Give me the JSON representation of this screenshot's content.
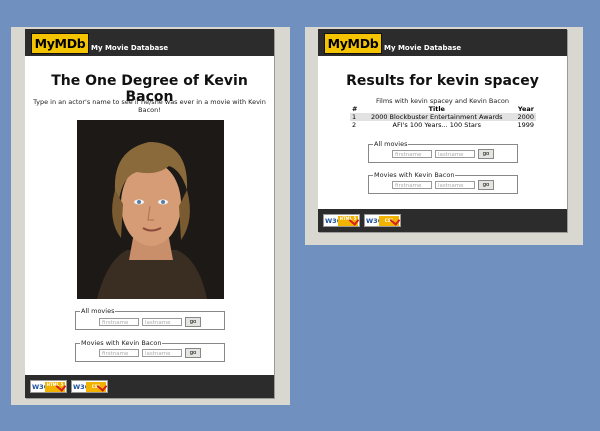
{
  "brand": {
    "logo": "MyMDb",
    "site_title": "My Movie Database"
  },
  "home": {
    "heading": "The One Degree of Kevin Bacon",
    "instructions": "Type in an actor's name to see if he/she was ever in a movie with Kevin Bacon!",
    "photo_alt": "Kevin Bacon",
    "all_movies": {
      "legend": "All movies",
      "first_placeholder": "firstname",
      "last_placeholder": "lastname",
      "go_label": "go"
    },
    "with_bacon": {
      "legend": "Movies with Kevin Bacon",
      "first_placeholder": "firstname",
      "last_placeholder": "lastname",
      "go_label": "go"
    }
  },
  "results": {
    "heading": "Results for kevin spacey",
    "caption": "Films with kevin spacey and Kevin Bacon",
    "columns": [
      "#",
      "Title",
      "Year"
    ],
    "rows": [
      {
        "num": "1",
        "title": "2000 Blockbuster Entertainment Awards",
        "year": "2000"
      },
      {
        "num": "2",
        "title": "AFI's 100 Years... 100 Stars",
        "year": "1999"
      }
    ],
    "all_movies": {
      "legend": "All movies",
      "first_placeholder": "firstname",
      "last_placeholder": "lastname",
      "go_label": "go"
    },
    "with_bacon": {
      "legend": "Movies with Kevin Bacon",
      "first_placeholder": "firstname",
      "last_placeholder": "lastname",
      "go_label": "go"
    }
  },
  "validators": {
    "html_label": "HTML 5",
    "css_label": "CSS",
    "w3c": "W3C"
  },
  "colors": {
    "background": "#7090c0",
    "banner": "#2c2c2c",
    "logo": "#f4c400"
  }
}
